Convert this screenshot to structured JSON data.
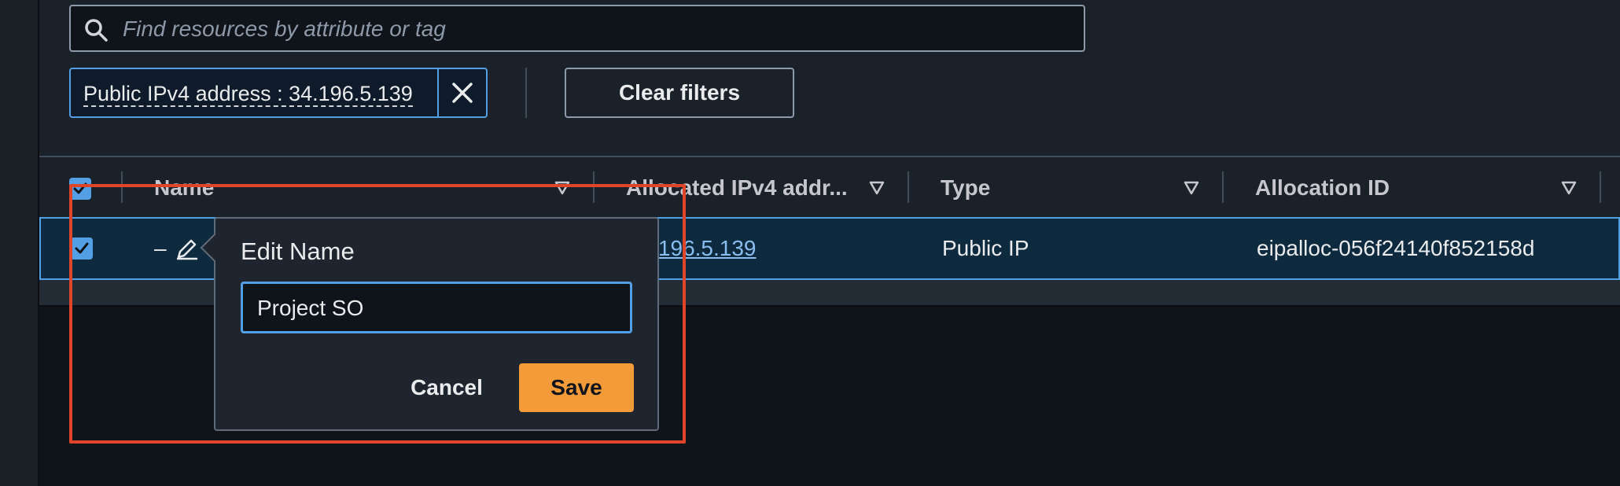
{
  "search": {
    "placeholder": "Find resources by attribute or tag",
    "value": ""
  },
  "filter_token": {
    "label": "Public IPv4 address : 34.196.5.139"
  },
  "clear_filters_label": "Clear filters",
  "table": {
    "columns": [
      "Name",
      "Allocated IPv4 addr...",
      "Type",
      "Allocation ID"
    ],
    "row": {
      "name": "–",
      "ipv4": "34.196.5.139",
      "type": "Public IP",
      "allocation_id": "eipalloc-056f24140f852158d"
    }
  },
  "edit_popover": {
    "title": "Edit Name",
    "input_value": "Project SO",
    "cancel_label": "Cancel",
    "save_label": "Save"
  },
  "colors": {
    "accent_blue": "#539fe5",
    "save_orange": "#f49b39",
    "highlight_red": "#e0452a",
    "link": "#89bdee"
  },
  "icons": [
    "search-icon",
    "close-icon",
    "sort-caret-icon",
    "check-icon",
    "pencil-icon"
  ]
}
